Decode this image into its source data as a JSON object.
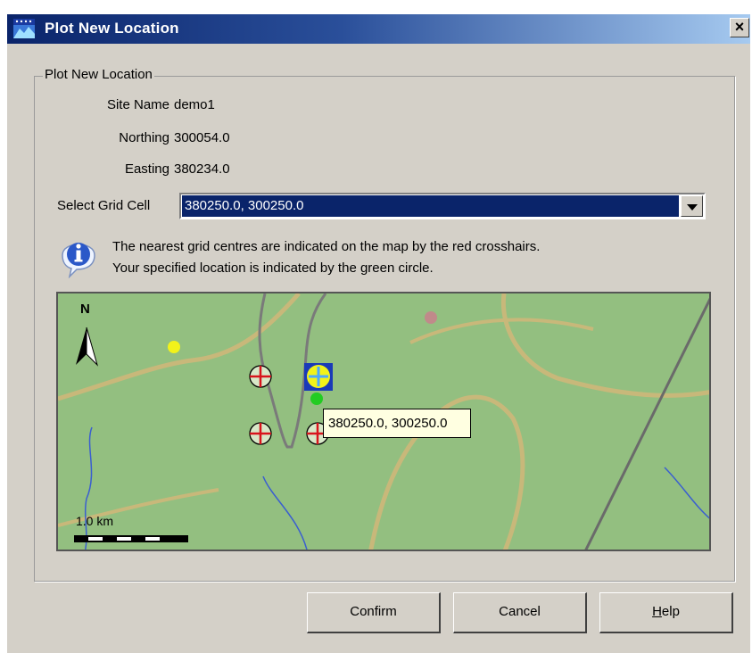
{
  "window": {
    "title": "Plot New Location",
    "close_glyph": "×"
  },
  "group": {
    "legend": "Plot New Location"
  },
  "fields": {
    "site_name_label": "Site Name",
    "site_name_value": "demo1",
    "northing_label": "Northing",
    "northing_value": "300054.0",
    "easting_label": "Easting",
    "easting_value": "380234.0",
    "grid_cell_label": "Select Grid Cell",
    "grid_cell_selected": "380250.0, 300250.0"
  },
  "info": {
    "line1": "The nearest grid centres are indicated on the map by the red crosshairs.",
    "line2": "Your specified location is indicated by the green circle."
  },
  "map": {
    "north_label": "N",
    "scale_label": "1.0 km",
    "tooltip": "380250.0, 300250.0",
    "colors": {
      "land": "#93bf80",
      "roads": "#c8b87a",
      "rivers": "#3a5ed0",
      "boundary": "#7a7a7a",
      "crosshair": "#d8141c",
      "selected": "#f2f21a",
      "location": "#22cc22"
    }
  },
  "buttons": {
    "confirm": "Confirm",
    "cancel": "Cancel",
    "help_pre": "",
    "help_u": "H",
    "help_post": "elp"
  }
}
